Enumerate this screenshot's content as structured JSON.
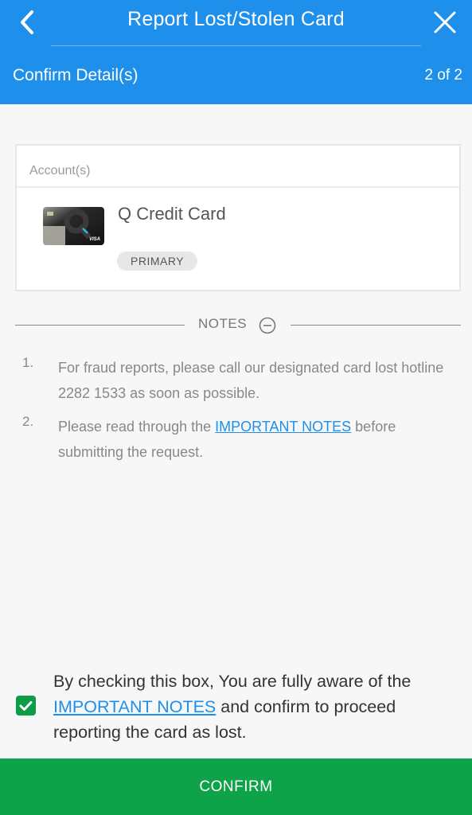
{
  "header": {
    "title": "Report Lost/Stolen Card",
    "subtitle": "Confirm Detail(s)",
    "step": "2 of 2"
  },
  "account": {
    "section_label": "Account(s)",
    "card_name": "Q Credit Card",
    "badge": "PRIMARY",
    "card_brand": "VISA",
    "card_image_icon": "credit-card-image"
  },
  "notes": {
    "label": "NOTES",
    "toggle_icon": "minus-circle-icon",
    "items": [
      {
        "number": "1.",
        "text": "For fraud reports, please call our designated card lost hotline 2282 1533 as soon as possible."
      },
      {
        "number": "2.",
        "text_before": "Please read through the ",
        "link": "IMPORTANT NOTES",
        "text_after": " before submitting the request."
      }
    ]
  },
  "consent": {
    "checked": true,
    "text_before": "By checking this box, You are fully aware of the ",
    "link": "IMPORTANT NOTES",
    "text_after": " and confirm to proceed reporting the card as lost."
  },
  "confirm_label": "CONFIRM",
  "colors": {
    "header": "#1e90ec",
    "confirm": "#0ea349",
    "link": "#1e90ec",
    "checkbox": "#0c9b47"
  }
}
